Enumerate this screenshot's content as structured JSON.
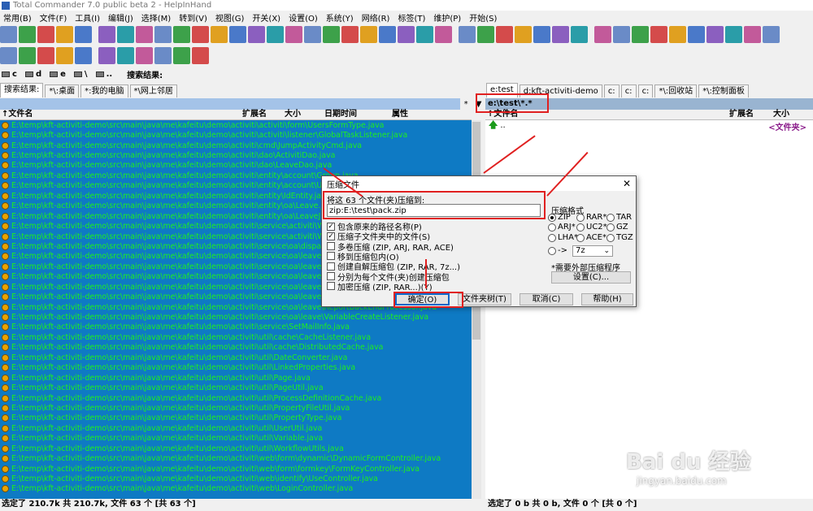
{
  "window": {
    "title": "Total Commander 7.0 public beta 2 - HelpInHand"
  },
  "menu": [
    "常用(B)",
    "文件(F)",
    "工具(I)",
    "编辑(J)",
    "选择(M)",
    "转到(V)",
    "视图(G)",
    "开关(X)",
    "设置(O)",
    "系统(Y)",
    "网络(R)",
    "标签(T)",
    "维护(P)",
    "开始(S)"
  ],
  "toolbar1_icons": [
    "wrench-icon",
    "wrench-icon",
    "wrench-icon",
    "wrench-icon",
    "wrench-icon",
    "brief-view-icon",
    "detailed-view-icon",
    "tree-view-icon",
    "compare-icon",
    "quick-view-icon",
    "thumbnail-icon",
    "sort-name-icon",
    "sort-ext-icon",
    "sort-size-icon",
    "sort-date-icon",
    "unsorted-icon",
    "invert-icon",
    "filter-icon",
    "select-icon",
    "unselect-icon",
    "select-all-icon",
    "compare-dirs-icon",
    "notes-icon",
    "multi-rename-icon",
    "run-icon",
    "network-icon",
    "settings-icon",
    "globe-icon",
    "ftp-icon",
    "shield-icon",
    "user-icon",
    "eject-icon",
    "cd-icon",
    "search-icon",
    "pack-icon",
    "unpack-icon",
    "unpack-all-icon",
    "refresh-icon",
    "calculator-icon",
    "compare-icon",
    "edit-icon"
  ],
  "toolbar2_icons": [
    "back-icon",
    "forward-icon",
    "pie-icon",
    "chart-icon",
    "sync-icon",
    "bubble-icon",
    "terminal-icon",
    "stats-icon",
    "stats-icon",
    "bars-icon",
    "arrows-icon"
  ],
  "drivebar": {
    "drives": [
      "c",
      "d",
      "e",
      "\\",
      ".."
    ],
    "search_label": "搜索结果:"
  },
  "left_tabs": [
    {
      "label": "搜索结果:",
      "active": true
    },
    {
      "label": "*\\:桌面",
      "active": false
    },
    {
      "label": "*:我的电脑",
      "active": false
    },
    {
      "label": "*\\网上邻居",
      "active": false
    }
  ],
  "right_tabs": [
    {
      "label": "e:test",
      "active": true
    },
    {
      "label": "d:kft-activiti-demo",
      "active": false
    },
    {
      "label": "c:",
      "active": false
    },
    {
      "label": "c:",
      "active": false
    },
    {
      "label": "c:",
      "active": false
    },
    {
      "label": "*\\:回收站",
      "active": false
    },
    {
      "label": "*\\:控制面板",
      "active": false
    }
  ],
  "left_path": "",
  "right_path": "e:\\test\\*.*",
  "path_buttons": [
    "*",
    "▼"
  ],
  "left_columns": {
    "name": "↑文件名",
    "ext": "扩展名",
    "size": "大小",
    "date": "日期时间",
    "attr": "属性"
  },
  "right_columns": {
    "name": "↑文件名",
    "ext": "扩展名",
    "size": "大小"
  },
  "left_files": [
    "E:\\temp\\kft-activiti-demo\\src\\main\\java\\me\\kafeitu\\demo\\activiti\\activiti\\form\\UsersFormType.java",
    "E:\\temp\\kft-activiti-demo\\src\\main\\java\\me\\kafeitu\\demo\\activiti\\activiti\\listener\\GlobalTaskListener.java",
    "E:\\temp\\kft-activiti-demo\\src\\main\\java\\me\\kafeitu\\demo\\activiti\\cmd\\JumpActivityCmd.java",
    "E:\\temp\\kft-activiti-demo\\src\\main\\java\\me\\kafeitu\\demo\\activiti\\dao\\ActivitiDao.java",
    "E:\\temp\\kft-activiti-demo\\src\\main\\java\\me\\kafeitu\\demo\\activiti\\dao\\LeaveDao.java",
    "E:\\temp\\kft-activiti-demo\\src\\main\\java\\me\\kafeitu\\demo\\activiti\\entity\\account\\Group.java",
    "E:\\temp\\kft-activiti-demo\\src\\main\\java\\me\\kafeitu\\demo\\activiti\\entity\\account\\User.java",
    "E:\\temp\\kft-activiti-demo\\src\\main\\java\\me\\kafeitu\\demo\\activiti\\entity\\IdEntity.java",
    "E:\\temp\\kft-activiti-demo\\src\\main\\java\\me\\kafeitu\\demo\\activiti\\entity\\oa\\Leave.java",
    "E:\\temp\\kft-activiti-demo\\src\\main\\java\\me\\kafeitu\\demo\\activiti\\entity\\oa\\LeaveJpa.java",
    "E:\\temp\\kft-activiti-demo\\src\\main\\java\\me\\kafeitu\\demo\\activiti\\service\\activiti\\WorkflowService.java",
    "E:\\temp\\kft-activiti-demo\\src\\main\\java\\me\\kafeitu\\demo\\activiti\\service\\activiti\\WorkflowTraceService.java",
    "E:\\temp\\kft-activiti-demo\\src\\main\\java\\me\\kafeitu\\demo\\activiti\\service\\oa\\dispatcher\\Dispatcher.java",
    "E:\\temp\\kft-activiti-demo\\src\\main\\java\\me\\kafeitu\\demo\\activiti\\service\\oa\\leave\\LeaveManager.java",
    "E:\\temp\\kft-activiti-demo\\src\\main\\java\\me\\kafeitu\\demo\\activiti\\service\\oa\\leave\\LeaveService.java",
    "E:\\temp\\kft-activiti-demo\\src\\main\\java\\me\\kafeitu\\demo\\activiti\\service\\oa\\leave\\LeaveWorkflowService.java",
    "E:\\temp\\kft-activiti-demo\\src\\main\\java\\me\\kafeitu\\demo\\activiti\\service\\oa\\leave\\ModifyApplyContent.java",
    "E:\\temp\\kft-activiti-demo\\src\\main\\java\\me\\kafeitu\\demo\\activiti\\service\\oa\\leave\\ReportBackProcessor.java",
    "E:\\temp\\kft-activiti-demo\\src\\main\\java\\me\\kafeitu\\demo\\activiti\\service\\oa\\leave\\ReportBackEndProcessor.java",
    "E:\\temp\\kft-activiti-demo\\src\\main\\java\\me\\kafeitu\\demo\\activiti\\service\\oa\\leave\\VariableCreateListener.java",
    "E:\\temp\\kft-activiti-demo\\src\\main\\java\\me\\kafeitu\\demo\\activiti\\service\\SetMailInfo.java",
    "E:\\temp\\kft-activiti-demo\\src\\main\\java\\me\\kafeitu\\demo\\activiti\\util\\cache\\CacheListener.java",
    "E:\\temp\\kft-activiti-demo\\src\\main\\java\\me\\kafeitu\\demo\\activiti\\util\\cache\\DistributedCache.java",
    "E:\\temp\\kft-activiti-demo\\src\\main\\java\\me\\kafeitu\\demo\\activiti\\util\\DateConverter.java",
    "E:\\temp\\kft-activiti-demo\\src\\main\\java\\me\\kafeitu\\demo\\activiti\\util\\LinkedProperties.java",
    "E:\\temp\\kft-activiti-demo\\src\\main\\java\\me\\kafeitu\\demo\\activiti\\util\\Page.java",
    "E:\\temp\\kft-activiti-demo\\src\\main\\java\\me\\kafeitu\\demo\\activiti\\util\\PageUtil.java",
    "E:\\temp\\kft-activiti-demo\\src\\main\\java\\me\\kafeitu\\demo\\activiti\\util\\ProcessDefinitionCache.java",
    "E:\\temp\\kft-activiti-demo\\src\\main\\java\\me\\kafeitu\\demo\\activiti\\util\\PropertyFileUtil.java",
    "E:\\temp\\kft-activiti-demo\\src\\main\\java\\me\\kafeitu\\demo\\activiti\\util\\PropertyType.java",
    "E:\\temp\\kft-activiti-demo\\src\\main\\java\\me\\kafeitu\\demo\\activiti\\util\\UserUtil.java",
    "E:\\temp\\kft-activiti-demo\\src\\main\\java\\me\\kafeitu\\demo\\activiti\\util\\Variable.java",
    "E:\\temp\\kft-activiti-demo\\src\\main\\java\\me\\kafeitu\\demo\\activiti\\util\\WorkflowUtils.java",
    "E:\\temp\\kft-activiti-demo\\src\\main\\java\\me\\kafeitu\\demo\\activiti\\web\\form\\dynamic\\DynamicFormController.java",
    "E:\\temp\\kft-activiti-demo\\src\\main\\java\\me\\kafeitu\\demo\\activiti\\web\\form\\formkey\\FormKeyController.java",
    "E:\\temp\\kft-activiti-demo\\src\\main\\java\\me\\kafeitu\\demo\\activiti\\web\\identify\\UseController.java",
    "E:\\temp\\kft-activiti-demo\\src\\main\\java\\me\\kafeitu\\demo\\activiti\\web\\LoginController.java"
  ],
  "right_panel": {
    "up_label": "..",
    "up_type": "<文件夹>"
  },
  "status": {
    "left": "选定了 210.7k 共 210.7k, 文件 63 个 [共 63 个]",
    "right": "选定了 0 b 共 0 b, 文件 0 个 [共 0 个]"
  },
  "dialog": {
    "title": "压缩文件",
    "close": "✕",
    "prompt": "将这 63 个文件(夹)压缩到:",
    "target": "zip:E:\\test\\pack.zip",
    "options": [
      {
        "label": "包含原来的路径名称(P)",
        "checked": true
      },
      {
        "label": "压缩子文件夹中的文件(S)",
        "checked": true
      },
      {
        "label": "多卷压缩 (ZIP, ARJ, RAR, ACE)",
        "checked": false
      },
      {
        "label": "移到压缩包内(O)",
        "checked": false
      },
      {
        "label": "创建自解压缩包 (ZIP, RAR, 7z...)",
        "checked": false
      },
      {
        "label": "分别为每个文件(夹)创建压缩包",
        "checked": false
      },
      {
        "label": "加密压缩 (ZIP, RAR...)(Y)",
        "checked": false
      }
    ],
    "format_title": "压缩格式",
    "formats": [
      {
        "label": "ZIP",
        "selected": true
      },
      {
        "label": "RAR*",
        "selected": false
      },
      {
        "label": "TAR",
        "selected": false
      },
      {
        "label": "ARJ*",
        "selected": false
      },
      {
        "label": "UC2*",
        "selected": false
      },
      {
        "label": "GZ",
        "selected": false
      },
      {
        "label": "LHA*",
        "selected": false
      },
      {
        "label": "ACE*",
        "selected": false
      },
      {
        "label": "TGZ",
        "selected": false
      },
      {
        "label": "->",
        "selected": false
      }
    ],
    "plugin_select": "7z",
    "ext_note": "*需要外部压缩程序",
    "buttons": {
      "settings": "设置(C)...",
      "ok": "确定(O)",
      "tree": "文件夹树(T)",
      "cancel": "取消(C)",
      "help": "帮助(H)"
    }
  },
  "watermark": {
    "brand": "Bai du 经验",
    "url": "jingyan.baidu.com"
  },
  "colors": {
    "selection": "#0e7ac4",
    "file_text": "#1ef01e",
    "annotation": "#e02020"
  }
}
